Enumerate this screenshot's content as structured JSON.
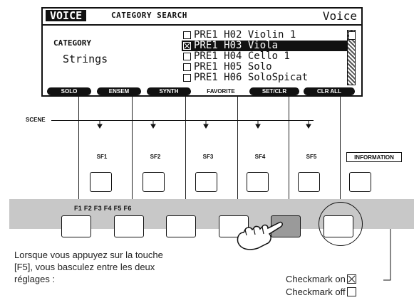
{
  "lcd": {
    "mode": "VOICE",
    "screen_title": "CATEGORY SEARCH",
    "screen_right": "Voice",
    "category_label": "CATEGORY",
    "category_value": "Strings",
    "voice_list": [
      {
        "text": "PRE1 H02 Violin 1",
        "checked": false,
        "selected": false
      },
      {
        "text": "PRE1 H03 Viola",
        "checked": true,
        "selected": true
      },
      {
        "text": "PRE1 H04 Cello 1",
        "checked": false,
        "selected": false
      },
      {
        "text": "PRE1 H05 Solo",
        "checked": false,
        "selected": false
      },
      {
        "text": "PRE1 H06 SoloSpicat",
        "checked": false,
        "selected": false
      }
    ],
    "tabs": [
      "SOLO",
      "ENSEM",
      "SYNTH",
      "FAVORITE",
      "SET/CLR",
      "CLR ALL"
    ]
  },
  "panel": {
    "scene_label": "SCENE",
    "sf_labels": [
      "SF1",
      "SF2",
      "SF3",
      "SF4",
      "SF5"
    ],
    "info_label": "INFORMATION",
    "f_labels": "F1 F2 F3 F4 F5 F6"
  },
  "note": {
    "line1": "Lorsque vous appuyez sur la touche",
    "line2": "[F5], vous basculez entre les deux",
    "line3": "réglages :"
  },
  "legend": {
    "on": "Checkmark on",
    "off": "Checkmark off"
  }
}
